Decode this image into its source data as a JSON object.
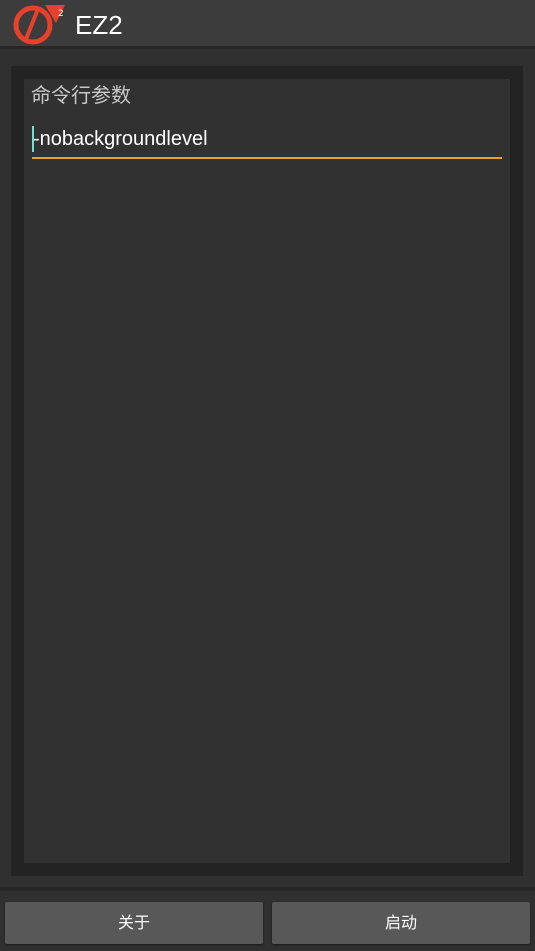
{
  "app": {
    "title": "EZ2",
    "logo_icon": "half-life-lambda-2-icon",
    "accent_color": "#f0a01f",
    "logo_color": "#e8402a"
  },
  "form": {
    "label": "命令行参数",
    "value": "-nobackgroundlevel"
  },
  "actions": {
    "about_label": "关于",
    "start_label": "启动"
  }
}
